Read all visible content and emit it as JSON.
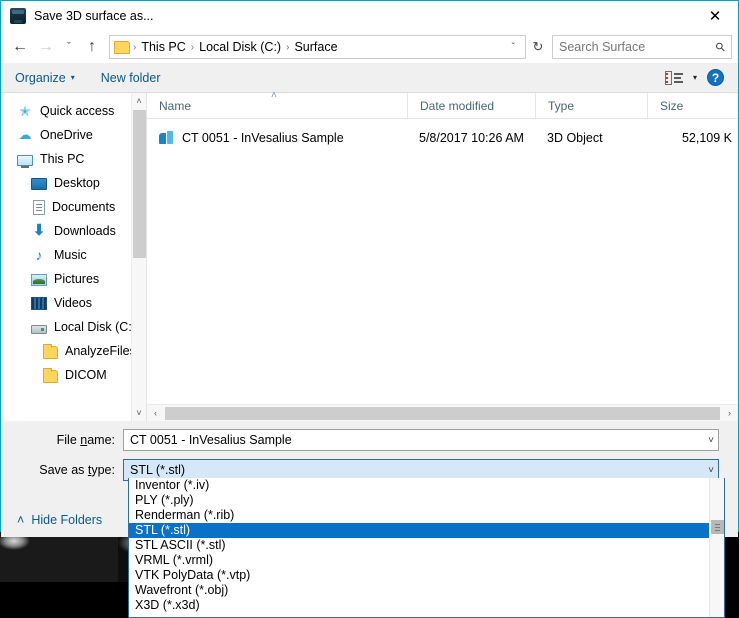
{
  "window": {
    "title": "Save 3D surface as...",
    "icon": "invesalius-icon",
    "close_label": "✕"
  },
  "nav": {
    "back": "←",
    "forward": "→",
    "recent": "ˇ",
    "up": "↑",
    "refresh": "↻",
    "breadcrumbs": [
      "This PC",
      "Local Disk (C:)",
      "Surface"
    ],
    "separator": "›",
    "dropdown_caret": "ˇ"
  },
  "search": {
    "placeholder": "Search Surface",
    "icon": "search-icon"
  },
  "commandbar": {
    "organize_label": "Organize",
    "organize_caret": "▾",
    "new_folder_label": "New folder",
    "view_mode_caret": "▾",
    "help_label": "?"
  },
  "sidebar": {
    "items": [
      {
        "label": "Quick access",
        "icon": "star-icon",
        "indent": 0
      },
      {
        "label": "OneDrive",
        "icon": "cloud-icon",
        "indent": 0
      },
      {
        "label": "This PC",
        "icon": "computer-icon",
        "indent": 0
      },
      {
        "label": "Desktop",
        "icon": "desktop-icon",
        "indent": 1
      },
      {
        "label": "Documents",
        "icon": "document-icon",
        "indent": 1
      },
      {
        "label": "Downloads",
        "icon": "download-icon",
        "indent": 1
      },
      {
        "label": "Music",
        "icon": "music-icon",
        "indent": 1
      },
      {
        "label": "Pictures",
        "icon": "picture-icon",
        "indent": 1
      },
      {
        "label": "Videos",
        "icon": "video-icon",
        "indent": 1
      },
      {
        "label": "Local Disk (C:)",
        "icon": "disk-icon",
        "indent": 1
      },
      {
        "label": "AnalyzeFiles",
        "icon": "folder-icon",
        "indent": 2
      },
      {
        "label": "DICOM",
        "icon": "folder-icon",
        "indent": 2
      }
    ],
    "scroll_up": "˄",
    "scroll_down": "˅"
  },
  "filelist": {
    "columns": [
      "Name",
      "Date modified",
      "Type",
      "Size"
    ],
    "sort_indicator": "˄",
    "rows": [
      {
        "name": "CT 0051 - InVesalius Sample",
        "date_modified": "5/8/2017 10:26 AM",
        "type": "3D Object",
        "size": "52,109 K",
        "icon": "3d-object-icon"
      }
    ],
    "hscroll_left": "‹",
    "hscroll_right": "›"
  },
  "form": {
    "file_name_label_pre": "File ",
    "file_name_label_underline": "n",
    "file_name_label_post": "ame:",
    "file_name_value": "CT 0051 - InVesalius Sample",
    "save_as_type_label_pre": "Save as ",
    "save_as_type_label_underline": "t",
    "save_as_type_label_post": "ype:",
    "save_as_type_value": "STL (*.stl)",
    "chevron": "˅",
    "hide_folders_label": "Hide Folders",
    "hide_folders_caret": "˄"
  },
  "dropdown": {
    "selected": "STL (*.stl)",
    "options": [
      "Inventor (*.iv)",
      "PLY (*.ply)",
      "Renderman (*.rib)",
      "STL (*.stl)",
      "STL ASCII (*.stl)",
      "VRML (*.vrml)",
      "VTK PolyData (*.vtp)",
      "Wavefront (*.obj)",
      "X3D (*.x3d)"
    ]
  },
  "colors": {
    "window_border": "#00a2c8",
    "selection_blue": "#0a71c8",
    "combo_open_fill": "#d6e8f7",
    "link_blue": "#0a5a8a",
    "folder_yellow": "#ffd75e"
  }
}
